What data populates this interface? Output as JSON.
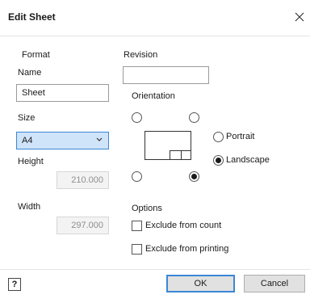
{
  "dialog": {
    "title": "Edit Sheet"
  },
  "icons": {
    "close": "close-icon",
    "chevron": "chevron-down-icon",
    "help": "help-icon"
  },
  "format": {
    "section_label": "Format",
    "name_label": "Name",
    "name_value": "Sheet",
    "size_label": "Size",
    "size_value": "A4",
    "height_label": "Height",
    "height_value": "210.000",
    "width_label": "Width",
    "width_value": "297.000"
  },
  "revision": {
    "label": "Revision",
    "value": ""
  },
  "orientation": {
    "label": "Orientation",
    "portrait_label": "Portrait",
    "landscape_label": "Landscape",
    "selected": "landscape",
    "corner_selected": "bottom-right"
  },
  "options": {
    "label": "Options",
    "exclude_count_label": "Exclude from count",
    "exclude_count_checked": false,
    "exclude_printing_label": "Exclude from printing",
    "exclude_printing_checked": false
  },
  "buttons": {
    "help_label": "?",
    "ok_label": "OK",
    "cancel_label": "Cancel"
  },
  "colors": {
    "accent": "#3c87d6",
    "select_bg": "#cfe4f9",
    "button_bg": "#e1e1e1"
  }
}
